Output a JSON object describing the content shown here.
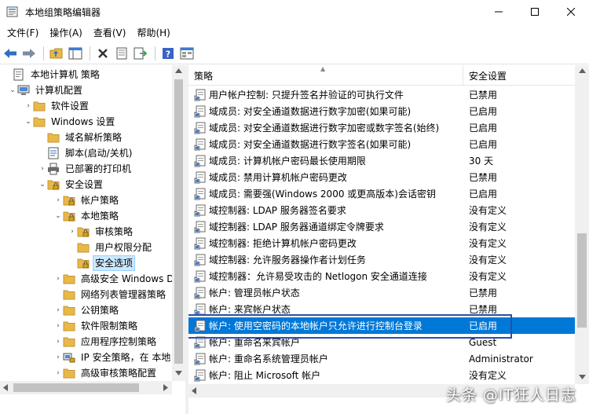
{
  "window": {
    "title": "本地组策略编辑器"
  },
  "menu": [
    {
      "label": "文件(F)"
    },
    {
      "label": "操作(A)"
    },
    {
      "label": "查看(V)"
    },
    {
      "label": "帮助(H)"
    }
  ],
  "toolbar": {
    "buttons": [
      "back-icon",
      "forward-icon",
      "up-folder-icon",
      "show-hide-tree-icon",
      "delete-icon",
      "properties-icon",
      "export-icon",
      "help-icon",
      "view-icon"
    ]
  },
  "tree": [
    {
      "label": "本地计算机 策略",
      "level": 0,
      "expander": "",
      "icon": "computer-policy-icon"
    },
    {
      "label": "计算机配置",
      "level": 1,
      "expander": "open",
      "icon": "computer-icon"
    },
    {
      "label": "软件设置",
      "level": 2,
      "expander": "closed",
      "icon": "folder-icon"
    },
    {
      "label": "Windows 设置",
      "level": 2,
      "expander": "open",
      "icon": "folder-icon"
    },
    {
      "label": "域名解析策略",
      "level": 3,
      "expander": "",
      "icon": "folder-icon"
    },
    {
      "label": "脚本(启动/关机)",
      "level": 3,
      "expander": "",
      "icon": "script-icon"
    },
    {
      "label": "已部署的打印机",
      "level": 3,
      "expander": "closed",
      "icon": "printer-icon"
    },
    {
      "label": "安全设置",
      "level": 3,
      "expander": "open",
      "icon": "lock-folder-icon"
    },
    {
      "label": "帐户策略",
      "level": 4,
      "expander": "closed",
      "icon": "lock-folder-icon"
    },
    {
      "label": "本地策略",
      "level": 4,
      "expander": "open",
      "icon": "lock-folder-icon"
    },
    {
      "label": "审核策略",
      "level": 5,
      "expander": "closed",
      "icon": "lock-folder-icon"
    },
    {
      "label": "用户权限分配",
      "level": 5,
      "expander": "",
      "icon": "folder-icon"
    },
    {
      "label": "安全选项",
      "level": 5,
      "expander": "",
      "icon": "lock-folder-icon",
      "selected": true
    },
    {
      "label": "高级安全 Windows D",
      "level": 4,
      "expander": "closed",
      "icon": "folder-icon"
    },
    {
      "label": "网络列表管理器策略",
      "level": 4,
      "expander": "",
      "icon": "folder-icon"
    },
    {
      "label": "公钥策略",
      "level": 4,
      "expander": "closed",
      "icon": "folder-icon"
    },
    {
      "label": "软件限制策略",
      "level": 4,
      "expander": "closed",
      "icon": "folder-icon"
    },
    {
      "label": "应用程序控制策略",
      "level": 4,
      "expander": "closed",
      "icon": "folder-icon"
    },
    {
      "label": "IP 安全策略，在 本地",
      "level": 4,
      "expander": "closed",
      "icon": "ip-security-icon"
    },
    {
      "label": "高级审核策略配置",
      "level": 4,
      "expander": "closed",
      "icon": "folder-icon"
    }
  ],
  "list": {
    "columns": {
      "policy": "策略",
      "setting": "安全设置"
    },
    "rows": [
      {
        "policy": "用户帐户控制: 只提升签名并验证的可执行文件",
        "setting": "已禁用"
      },
      {
        "policy": "域成员: 对安全通道数据进行数字加密(如果可能)",
        "setting": "已启用"
      },
      {
        "policy": "域成员: 对安全通道数据进行数字加密或数字签名(始终)",
        "setting": "已启用"
      },
      {
        "policy": "域成员: 对安全通道数据进行数字签名(如果可能)",
        "setting": "已启用"
      },
      {
        "policy": "域成员: 计算机帐户密码最长使用期限",
        "setting": "30 天"
      },
      {
        "policy": "域成员: 禁用计算机帐户密码更改",
        "setting": "已禁用"
      },
      {
        "policy": "域成员: 需要强(Windows 2000 或更高版本)会话密钥",
        "setting": "已启用"
      },
      {
        "policy": "域控制器: LDAP 服务器签名要求",
        "setting": "没有定义"
      },
      {
        "policy": "域控制器: LDAP 服务器通道绑定令牌要求",
        "setting": "没有定义"
      },
      {
        "policy": "域控制器: 拒绝计算机帐户密码更改",
        "setting": "没有定义"
      },
      {
        "policy": "域控制器: 允许服务器操作者计划任务",
        "setting": "没有定义"
      },
      {
        "policy": "域控制器：允许易受攻击的 Netlogon 安全通道连接",
        "setting": "没有定义"
      },
      {
        "policy": "帐户: 管理员帐户状态",
        "setting": "已禁用"
      },
      {
        "policy": "帐户: 来宾帐户状态",
        "setting": "已禁用"
      },
      {
        "policy": "帐户: 使用空密码的本地帐户只允许进行控制台登录",
        "setting": "已启用",
        "selected": true
      },
      {
        "policy": "帐户: 重命名来宾帐户",
        "setting": "Guest"
      },
      {
        "policy": "帐户: 重命名系统管理员帐户",
        "setting": "Administrator"
      },
      {
        "policy": "帐户: 阻止 Microsoft 帐户",
        "setting": "没有定义"
      }
    ]
  },
  "watermark": "头条 @IT狂人日志",
  "colors": {
    "selection": "#0078d7",
    "highlight_box": "#2850a8",
    "folder": "#e8b94a"
  }
}
